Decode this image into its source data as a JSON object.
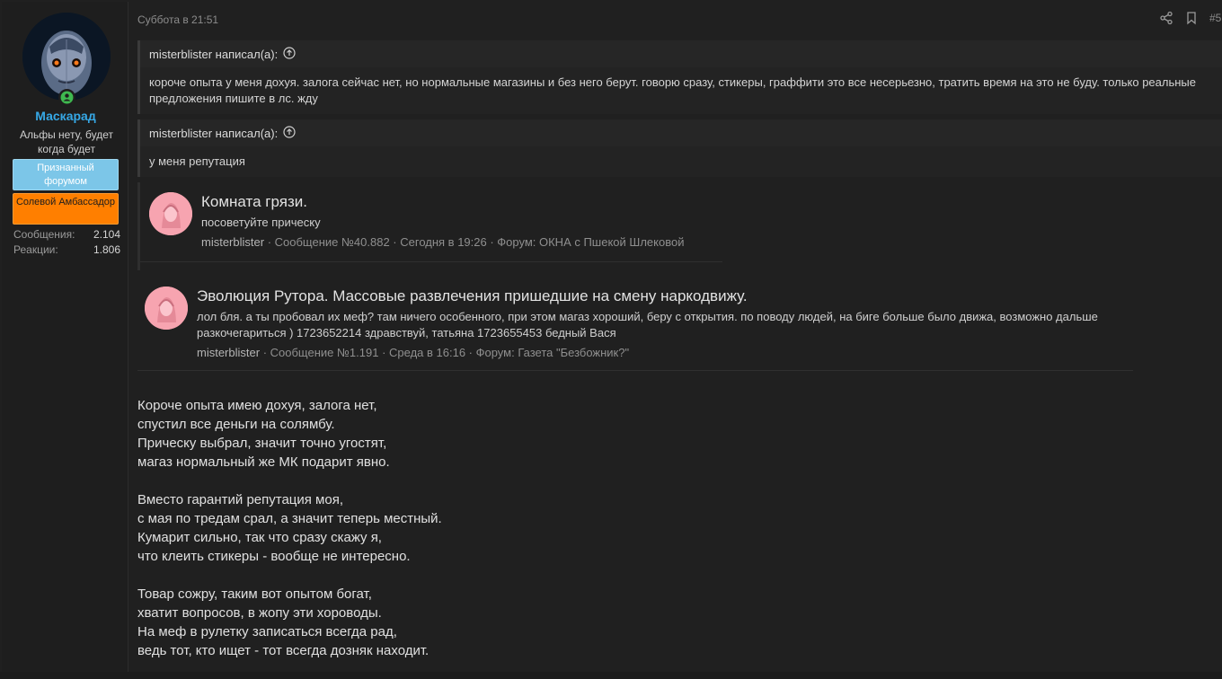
{
  "user": {
    "name": "Маскарад",
    "title": "Альфы нету, будет когда будет",
    "banners": [
      "Признанный форумом",
      "Солевой Амбассадор"
    ],
    "stats": [
      {
        "label": "Сообщения:",
        "value": "2.104"
      },
      {
        "label": "Реакции:",
        "value": "1.806"
      }
    ],
    "avatar_icon": "masked-face-avatar",
    "online_icon": "online-status-icon"
  },
  "post": {
    "date": "Суббота в 21:51",
    "number": "#5",
    "share_icon": "share-icon",
    "bookmark_icon": "bookmark-icon"
  },
  "quotes": [
    {
      "author": "misterblister написал(а):",
      "text": "короче опыта у меня дохуя. залога сейчас нет, но нормальные магазины и без него берут. говорю сразу, стикеры, граффити это все несерьезно, тратить время на это не буду. только реальные предложения пишите в лс. жду"
    },
    {
      "author": "misterblister написал(а):",
      "text": "у меня репутация"
    }
  ],
  "embeds": [
    {
      "title": "Комната грязи.",
      "snippet": "посоветуйте прическу",
      "author": "misterblister",
      "meta": " · Сообщение №40.882 · Сегодня в 19:26 · Форум: ОКНА с Пшекой Шлековой"
    },
    {
      "title": "Эволюция Рутора. Массовые развлечения пришедшие на смену наркодвижу.",
      "snippet": "лол бля. а ты пробовал их меф? там ничего особенного, при этом магаз хороший, беру с открытия. по поводу людей, на биге больше было движа, возможно дальше разкочегариться ) 1723652214 здравствуй, татьяна 1723655453 бедный Вася",
      "author": "misterblister",
      "meta": " · Сообщение №1.191 · Среда в 16:16 · Форум: Газета \"Безбожник?\""
    }
  ],
  "poem": [
    [
      "Короче опыта имею дохуя, залога нет,",
      "спустил все деньги на солямбу.",
      "Прическу выбрал, значит точно угостят,",
      "магаз нормальный же МК подарит явно."
    ],
    [
      "Вместо гарантий репутация моя,",
      "с мая по тредам срал, а значит теперь местный.",
      "Кумарит сильно, так что сразу скажу я,",
      "что клеить стикеры - вообще не интересно."
    ],
    [
      "Товар сожру, таким вот опытом богат,",
      "хватит вопросов, в жопу эти хороводы.",
      "На меф в рулетку записаться всегда рад,",
      "ведь тот, кто ищет - тот всегда дозняк находит."
    ]
  ],
  "colors": {
    "username": "#36a8e6",
    "banner_blue": "#7cc6e8",
    "banner_orange": "#ff7f00",
    "online": "#3fb950"
  }
}
